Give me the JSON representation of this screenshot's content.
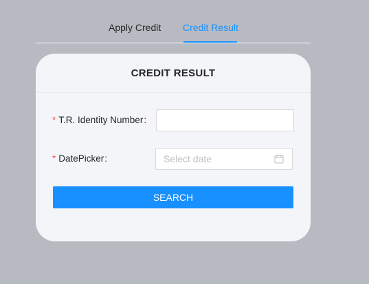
{
  "tabs": [
    {
      "label": "Apply Credit",
      "active": false
    },
    {
      "label": "Credit Result",
      "active": true
    }
  ],
  "card": {
    "title": "CREDIT RESULT"
  },
  "form": {
    "required_mark": "*",
    "identity": {
      "label": "T.R. Identity Number",
      "colon": ":",
      "value": ""
    },
    "date": {
      "label": "DatePicker",
      "colon": ":",
      "placeholder": "Select date",
      "icon": "calendar-icon"
    },
    "search_label": "SEARCH"
  },
  "colors": {
    "background": "#b8bac2",
    "card": "#f4f5f9",
    "accent": "#1890ff",
    "required": "#ff4d4f"
  }
}
